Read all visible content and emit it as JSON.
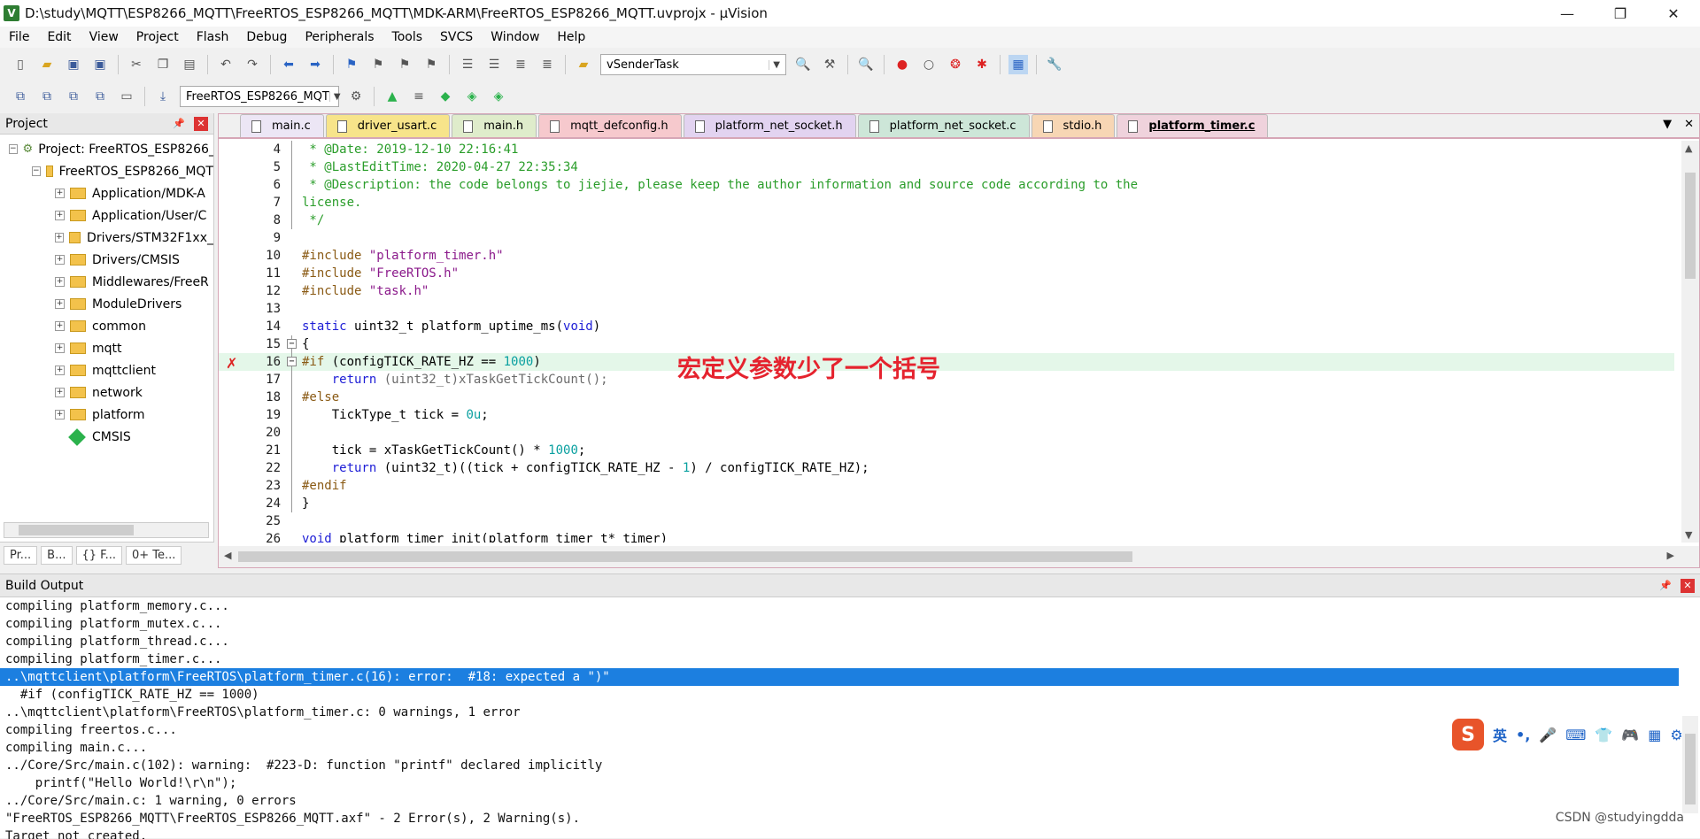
{
  "window": {
    "title": "D:\\study\\MQTT\\ESP8266_MQTT\\FreeRTOS_ESP8266_MQTT\\MDK-ARM\\FreeRTOS_ESP8266_MQTT.uvprojx - µVision",
    "icon": "uvision-icon",
    "minimize": "—",
    "maximize": "❐",
    "close": "✕"
  },
  "menu": [
    "File",
    "Edit",
    "View",
    "Project",
    "Flash",
    "Debug",
    "Peripherals",
    "Tools",
    "SVCS",
    "Window",
    "Help"
  ],
  "toolbar1": {
    "target_combo": "vSenderTask"
  },
  "toolbar2": {
    "project_combo": "FreeRTOS_ESP8266_MQT"
  },
  "project_panel": {
    "title": "Project",
    "root": "Project: FreeRTOS_ESP8266_",
    "target": "FreeRTOS_ESP8266_MQT",
    "groups": [
      "Application/MDK-A",
      "Application/User/C",
      "Drivers/STM32F1xx_",
      "Drivers/CMSIS",
      "Middlewares/FreeR",
      "ModuleDrivers",
      "common",
      "mqtt",
      "mqttclient",
      "network",
      "platform"
    ],
    "cmsis": "CMSIS",
    "bottom_tabs": [
      "Pr...",
      "B...",
      "{} F...",
      "0+ Te..."
    ]
  },
  "editor": {
    "tabs": [
      {
        "label": "main.c",
        "color": "#ece6f5"
      },
      {
        "label": "driver_usart.c",
        "color": "#f7e48a"
      },
      {
        "label": "main.h",
        "color": "#dfeccb"
      },
      {
        "label": "mqtt_defconfig.h",
        "color": "#f6c9cd"
      },
      {
        "label": "platform_net_socket.h",
        "color": "#e2d3f0"
      },
      {
        "label": "platform_net_socket.c",
        "color": "#cde6d8"
      },
      {
        "label": "stdio.h",
        "color": "#f7d6b4"
      },
      {
        "label": "platform_timer.c",
        "color": "#efd2dc"
      }
    ],
    "active_tab": "platform_timer.c",
    "lines": [
      {
        "n": "4",
        "t": " * @Date: 2019-12-10 22:16:41"
      },
      {
        "n": "5",
        "t": " * @LastEditTime: 2020-04-27 22:35:34"
      },
      {
        "n": "6",
        "t": " * @Description: the code belongs to jiejie, please keep the author information and source code according to the"
      },
      {
        "n": "7",
        "t": "license."
      },
      {
        "n": "8",
        "t": " */"
      },
      {
        "n": "9",
        "t": ""
      },
      {
        "n": "10",
        "t": "#include \"platform_timer.h\""
      },
      {
        "n": "11",
        "t": "#include \"FreeRTOS.h\""
      },
      {
        "n": "12",
        "t": "#include \"task.h\""
      },
      {
        "n": "13",
        "t": ""
      },
      {
        "n": "14",
        "t": "static uint32_t platform_uptime_ms(void)"
      },
      {
        "n": "15",
        "t": "{"
      },
      {
        "n": "16",
        "t": "#if (configTICK_RATE_HZ == 1000)"
      },
      {
        "n": "17",
        "t": "    return (uint32_t)xTaskGetTickCount();"
      },
      {
        "n": "18",
        "t": "#else"
      },
      {
        "n": "19",
        "t": "    TickType_t tick = 0u;"
      },
      {
        "n": "20",
        "t": ""
      },
      {
        "n": "21",
        "t": "    tick = xTaskGetTickCount() * 1000;"
      },
      {
        "n": "22",
        "t": "    return (uint32_t)((tick + configTICK_RATE_HZ - 1) / configTICK_RATE_HZ);"
      },
      {
        "n": "23",
        "t": "#endif"
      },
      {
        "n": "24",
        "t": "}"
      },
      {
        "n": "25",
        "t": ""
      },
      {
        "n": "26",
        "t": "void platform_timer_init(platform_timer_t* timer)"
      }
    ],
    "annotation": "宏定义参数少了一个括号"
  },
  "build_output": {
    "title": "Build Output",
    "lines": [
      "compiling platform_memory.c...",
      "compiling platform_mutex.c...",
      "compiling platform_thread.c...",
      "compiling platform_timer.c...",
      "..\\mqttclient\\platform\\FreeRTOS\\platform_timer.c(16): error:  #18: expected a \")\"",
      "  #if (configTICK_RATE_HZ == 1000)",
      "..\\mqttclient\\platform\\FreeRTOS\\platform_timer.c: 0 warnings, 1 error",
      "compiling freertos.c...",
      "compiling main.c...",
      "../Core/Src/main.c(102): warning:  #223-D: function \"printf\" declared implicitly",
      "    printf(\"Hello World!\\r\\n\");",
      "../Core/Src/main.c: 1 warning, 0 errors",
      "\"FreeRTOS_ESP8266_MQTT\\FreeRTOS_ESP8266_MQTT.axf\" - 2 Error(s), 2 Warning(s).",
      "Target not created."
    ],
    "selected_index": 4
  },
  "ime": {
    "logo": "S",
    "items": [
      "英",
      "•,",
      "🎤",
      "⌨",
      "👕",
      "🎮",
      "▦",
      "⚙"
    ]
  },
  "watermark": "CSDN @studyingdda"
}
